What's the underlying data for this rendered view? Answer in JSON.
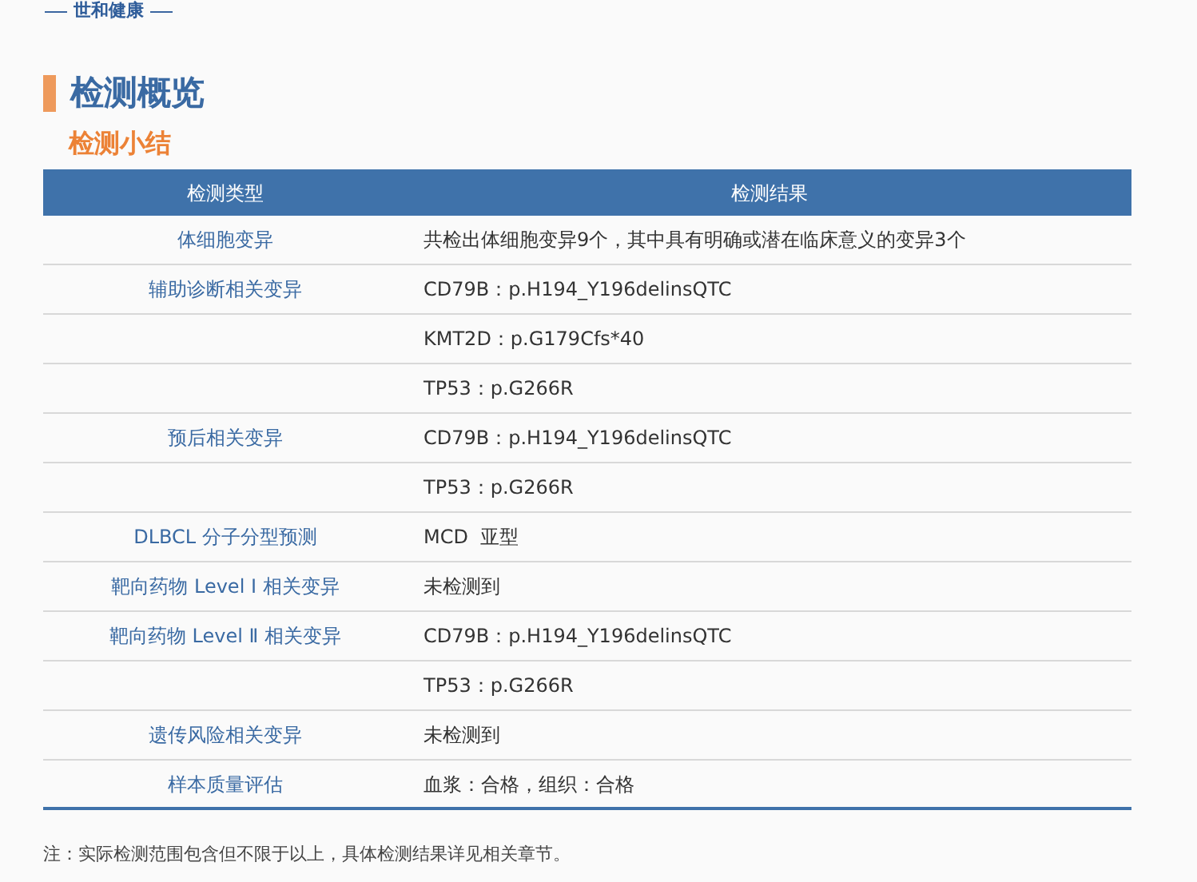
{
  "brand": "世和健康",
  "section_title": "检测概览",
  "subsection_title": "检测小结",
  "table": {
    "columns": [
      "检测类型",
      "检测结果"
    ],
    "rows": [
      {
        "type": "体细胞变异",
        "result": "共检出体细胞变异9个，其中具有明确或潜在临床意义的变异3个"
      },
      {
        "type": "辅助诊断相关变异",
        "result": "CD79B：p.H194_Y196delinsQTC"
      },
      {
        "result": "KMT2D：p.G179Cfs*40"
      },
      {
        "result": "TP53：p.G266R"
      },
      {
        "type": "预后相关变异",
        "result": "CD79B：p.H194_Y196delinsQTC"
      },
      {
        "result": "TP53：p.G266R"
      },
      {
        "type": "DLBCL 分子分型预测",
        "result": "MCD  亚型"
      },
      {
        "type": "靶向药物 Level Ⅰ 相关变异",
        "result": "未检测到"
      },
      {
        "type": "靶向药物 Level Ⅱ 相关变异",
        "result": "CD79B：p.H194_Y196delinsQTC"
      },
      {
        "result": "TP53：p.G266R"
      },
      {
        "type": "遗传风险相关变异",
        "result": "未检测到"
      },
      {
        "type": "样本质量评估",
        "result": "血浆：合格，组织：合格"
      }
    ]
  },
  "note": "注：实际检测范围包含但不限于以上，具体检测结果详见相关章节。"
}
